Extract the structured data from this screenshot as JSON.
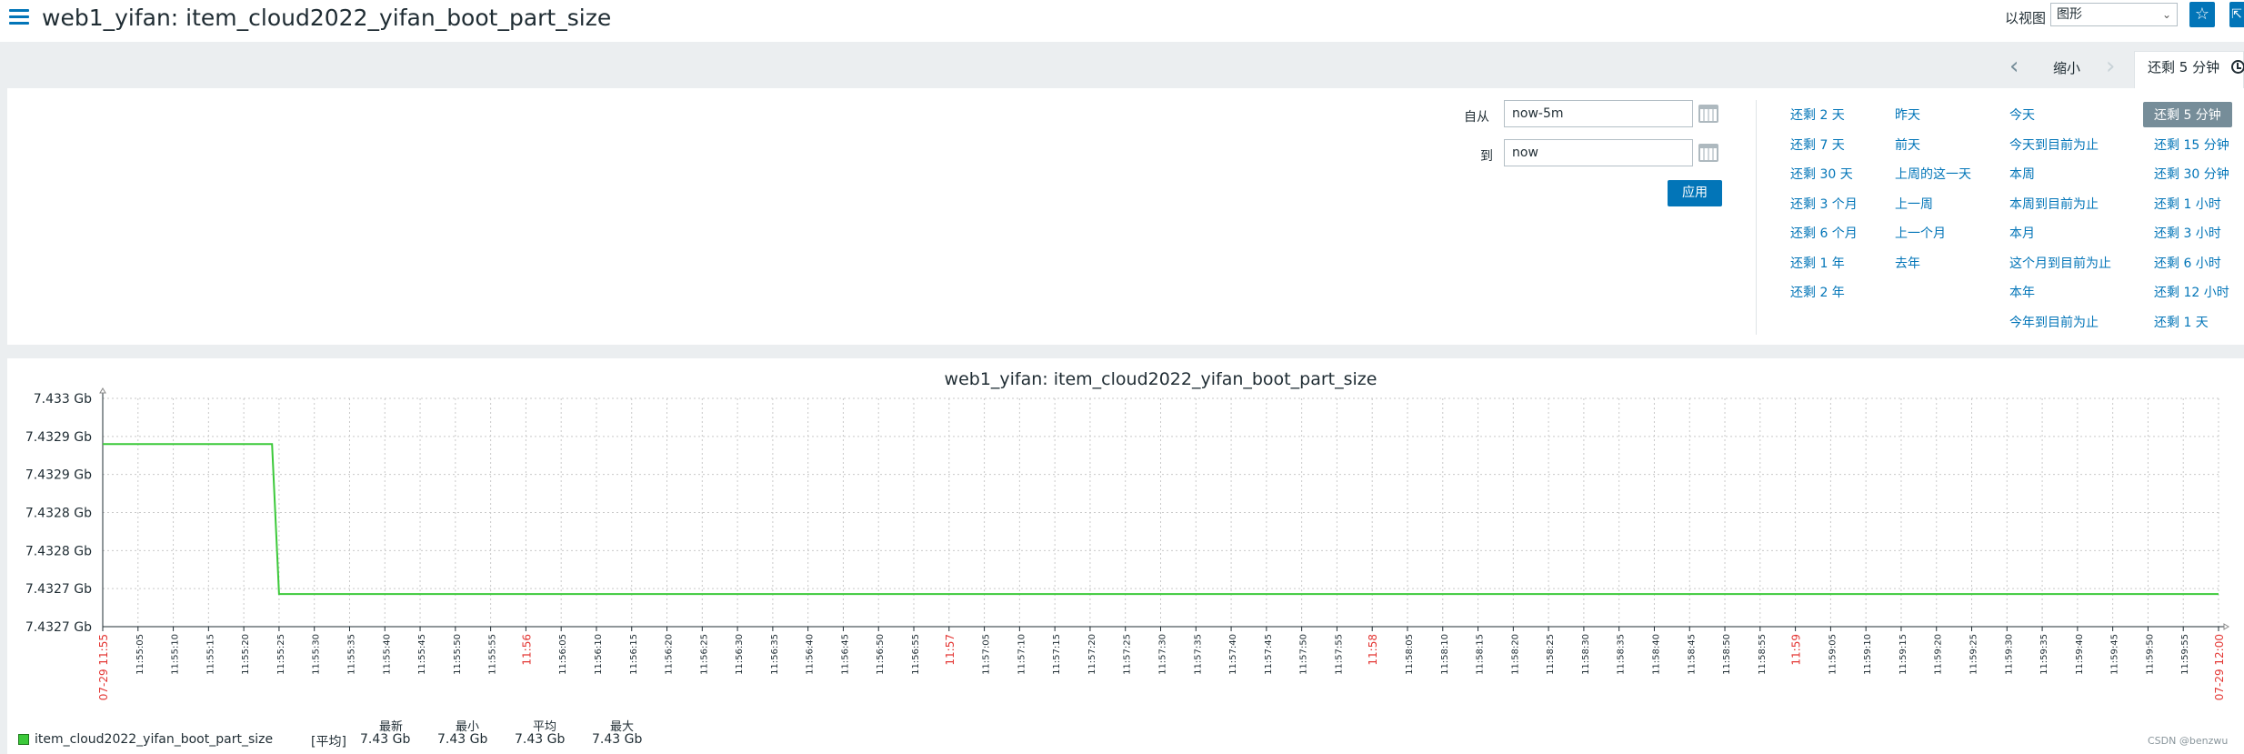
{
  "page": {
    "title": "web1_yifan: item_cloud2022_yifan_boot_part_size",
    "view_as_label": "以视图",
    "view_as_value": "图形"
  },
  "timebar": {
    "zoom_out_label": "缩小",
    "tab_label": "还剩 5 分钟"
  },
  "time_filter": {
    "from_label": "自从",
    "from_value": "now-5m",
    "to_label": "到",
    "to_value": "now",
    "apply_label": "应用",
    "quick_ranges": [
      [
        "还剩 2 天",
        "还剩 7 天",
        "还剩 30 天",
        "还剩 3 个月",
        "还剩 6 个月",
        "还剩 1 年",
        "还剩 2 年"
      ],
      [
        "昨天",
        "前天",
        "上周的这一天",
        "上一周",
        "上一个月",
        "去年"
      ],
      [
        "今天",
        "今天到目前为止",
        "本周",
        "本周到目前为止",
        "本月",
        "这个月到目前为止",
        "本年",
        "今年到目前为止"
      ],
      [
        "还剩 5 分钟",
        "还剩 15 分钟",
        "还剩 30 分钟",
        "还剩 1 小时",
        "还剩 3 小时",
        "还剩 6 小时",
        "还剩 12 小时",
        "还剩 1 天"
      ]
    ],
    "active_range": "还剩 5 分钟"
  },
  "colors": {
    "accent": "#0275b8",
    "series": "#3cc93a",
    "red_tick": "#e33734"
  },
  "chart_data": {
    "type": "line",
    "title": "web1_yifan: item_cloud2022_yifan_boot_part_size",
    "y_tick_labels": [
      "7.433 Gb",
      "7.4329 Gb",
      "7.4329 Gb",
      "7.4328 Gb",
      "7.4328 Gb",
      "7.4327 Gb",
      "7.4327 Gb"
    ],
    "ylim": [
      7.43265,
      7.433
    ],
    "x_tick_labels": [
      "07-29 11:55",
      "11:55:05",
      "11:55:10",
      "11:55:15",
      "11:55:20",
      "11:55:25",
      "11:55:30",
      "11:55:35",
      "11:55:40",
      "11:55:45",
      "11:55:50",
      "11:55:55",
      "11:56",
      "11:56:05",
      "11:56:10",
      "11:56:15",
      "11:56:20",
      "11:56:25",
      "11:56:30",
      "11:56:35",
      "11:56:40",
      "11:56:45",
      "11:56:50",
      "11:56:55",
      "11:57",
      "11:57:05",
      "11:57:10",
      "11:57:15",
      "11:57:20",
      "11:57:25",
      "11:57:30",
      "11:57:35",
      "11:57:40",
      "11:57:45",
      "11:57:50",
      "11:57:55",
      "11:58",
      "11:58:05",
      "11:58:10",
      "11:58:15",
      "11:58:20",
      "11:58:25",
      "11:58:30",
      "11:58:35",
      "11:58:40",
      "11:58:45",
      "11:58:50",
      "11:58:55",
      "11:59",
      "11:59:05",
      "11:59:10",
      "11:59:15",
      "11:59:20",
      "11:59:25",
      "11:59:30",
      "11:59:35",
      "11:59:40",
      "11:59:45",
      "11:59:50",
      "11:59:55",
      "07-29 12:00"
    ],
    "red_ticks": [
      "07-29 11:55",
      "11:56",
      "11:57",
      "11:58",
      "11:59",
      "07-29 12:00"
    ],
    "series": [
      {
        "name": "item_cloud2022_yifan_boot_part_size",
        "x": [
          "11:55:00",
          "11:55:24",
          "11:55:25",
          "12:00:00"
        ],
        "y": [
          7.43293,
          7.43293,
          7.4327,
          7.4327
        ]
      }
    ],
    "grid": true
  },
  "legend": {
    "item_name": "item_cloud2022_yifan_boot_part_size",
    "func_label": "[平均]",
    "headers": [
      "最新",
      "最小",
      "平均",
      "最大"
    ],
    "values": [
      "7.43 Gb",
      "7.43 Gb",
      "7.43 Gb",
      "7.43 Gb"
    ]
  },
  "watermark": "CSDN @benzwu"
}
